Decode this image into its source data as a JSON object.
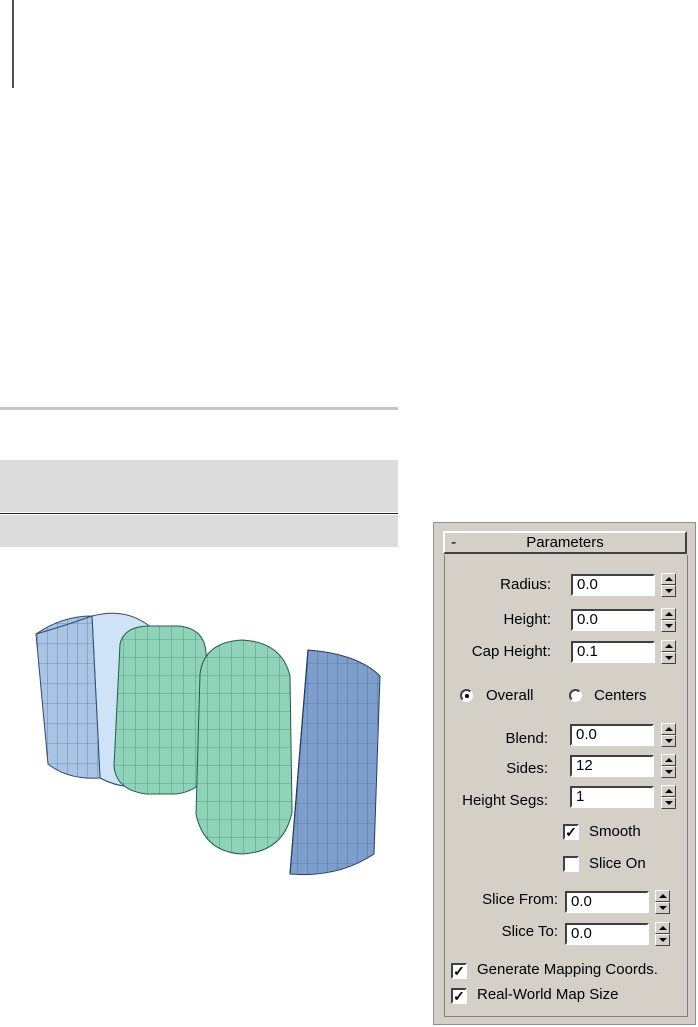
{
  "panel": {
    "title": "Parameters",
    "collapse_symbol": "-",
    "radius": {
      "label": "Radius:",
      "value": "0.0"
    },
    "height": {
      "label": "Height:",
      "value": "0.0"
    },
    "cap_height": {
      "label": "Cap Height:",
      "value": "0.1"
    },
    "overall": {
      "label": "Overall",
      "selected": true
    },
    "centers": {
      "label": "Centers",
      "selected": false
    },
    "blend": {
      "label": "Blend:",
      "value": "0.0"
    },
    "sides": {
      "label": "Sides:",
      "value": "12"
    },
    "height_segs": {
      "label": "Height Segs:",
      "value": "1"
    },
    "smooth": {
      "label": "Smooth",
      "checked": true
    },
    "slice_on": {
      "label": "Slice On",
      "checked": false
    },
    "slice_from": {
      "label": "Slice From:",
      "value": "0.0"
    },
    "slice_to": {
      "label": "Slice To:",
      "value": "0.0"
    },
    "gen_mapping": {
      "label": "Generate Mapping Coords.",
      "checked": true
    },
    "real_world": {
      "label": "Real-World Map Size",
      "checked": true
    },
    "check_mark": "✓"
  },
  "colors": {
    "panel_bg": "#d4d0c8",
    "blue_object": "#9fb9d9",
    "green_object": "#8fd3b8"
  }
}
